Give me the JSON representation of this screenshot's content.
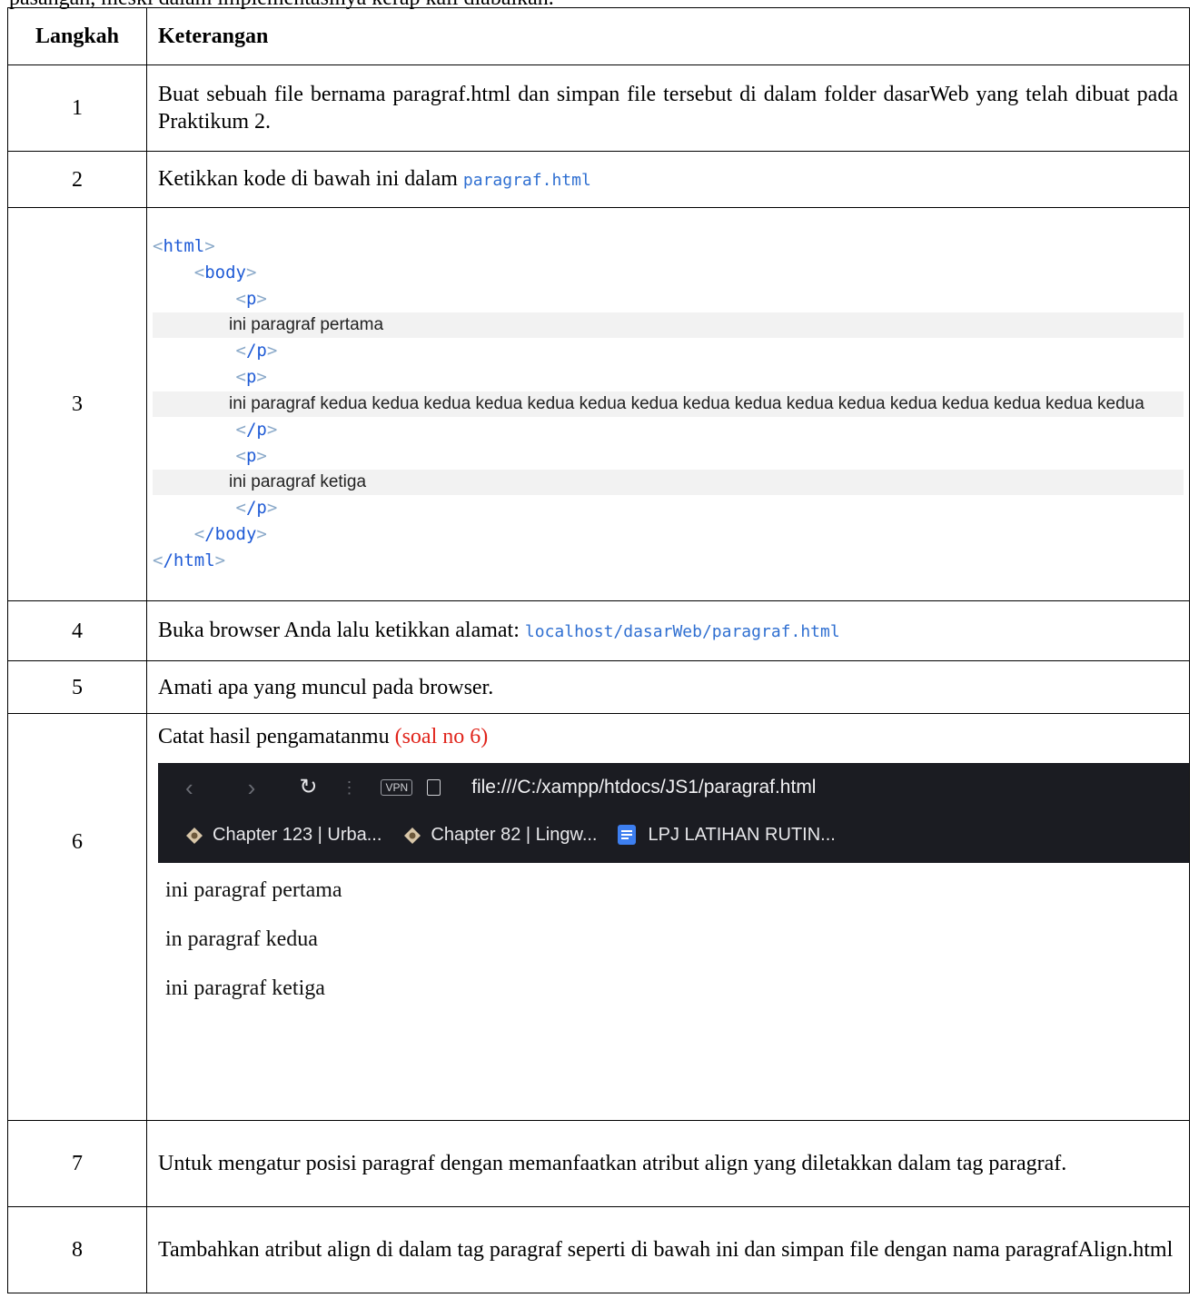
{
  "intro_cut": "pasangan, meski dalam implementasinya kerap kali diabaikan.",
  "header": {
    "step": "Langkah",
    "desc": "Keterangan"
  },
  "rows": {
    "r1": {
      "num": "1",
      "text": "Buat sebuah file bernama paragraf.html dan simpan file tersebut di dalam folder dasarWeb yang telah dibuat pada Praktikum 2."
    },
    "r2": {
      "num": "2",
      "text": "Ketikkan kode di bawah ini dalam ",
      "code": "paragraf.html"
    },
    "r3": {
      "num": "3",
      "code": {
        "html_open": "html",
        "body_open": "body",
        "p_open": "p",
        "p_close": "/p",
        "body_close": "/body",
        "html_close": "/html",
        "para1": "ini paragraf pertama",
        "para2": "ini paragraf kedua kedua kedua kedua kedua kedua kedua kedua kedua kedua kedua kedua kedua kedua kedua kedua",
        "para3": "ini paragraf ketiga"
      }
    },
    "r4": {
      "num": "4",
      "text": "Buka browser Anda lalu ketikkan alamat: ",
      "code": "localhost/dasarWeb/paragraf.html"
    },
    "r5": {
      "num": "5",
      "text": "Amati apa yang muncul pada browser."
    },
    "r6": {
      "num": "6",
      "text": "Catat hasil pengamatanmu ",
      "note": "(soal no 6)",
      "browser": {
        "vpn": "VPN",
        "url": "file:///C:/xampp/htdocs/JS1/paragraf.html",
        "bookmarks": [
          "Chapter 123 | Urba...",
          "Chapter 82 | Lingw...",
          "LPJ LATIHAN RUTIN..."
        ],
        "output": [
          "ini paragraf pertama",
          "in paragraf kedua",
          "ini paragraf ketiga"
        ]
      }
    },
    "r7": {
      "num": "7",
      "text": "Untuk mengatur posisi paragraf dengan memanfaatkan atribut align yang diletakkan dalam tag paragraf."
    },
    "r8": {
      "num": "8",
      "text": "Tambahkan atribut align di dalam tag paragraf seperti di bawah ini dan simpan file dengan nama paragrafAlign.html"
    }
  },
  "colors": {
    "code_blue": "#2f6fd1",
    "note_red": "#e0241b",
    "browser_bg": "#1b1c22"
  }
}
